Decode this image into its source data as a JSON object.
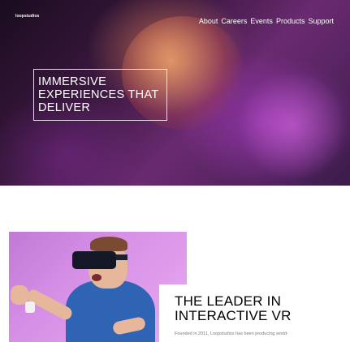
{
  "header": {
    "logo": "loopstudios",
    "nav": [
      {
        "label": "About"
      },
      {
        "label": "Careers"
      },
      {
        "label": "Events"
      },
      {
        "label": "Products"
      },
      {
        "label": "Support"
      }
    ]
  },
  "hero": {
    "title": "IMMERSIVE EXPERIENCES THAT DELIVER"
  },
  "about": {
    "title": "THE LEADER IN INTERACTIVE VR",
    "text": "Founded in 2011, Loopstudios has been producing world-"
  }
}
